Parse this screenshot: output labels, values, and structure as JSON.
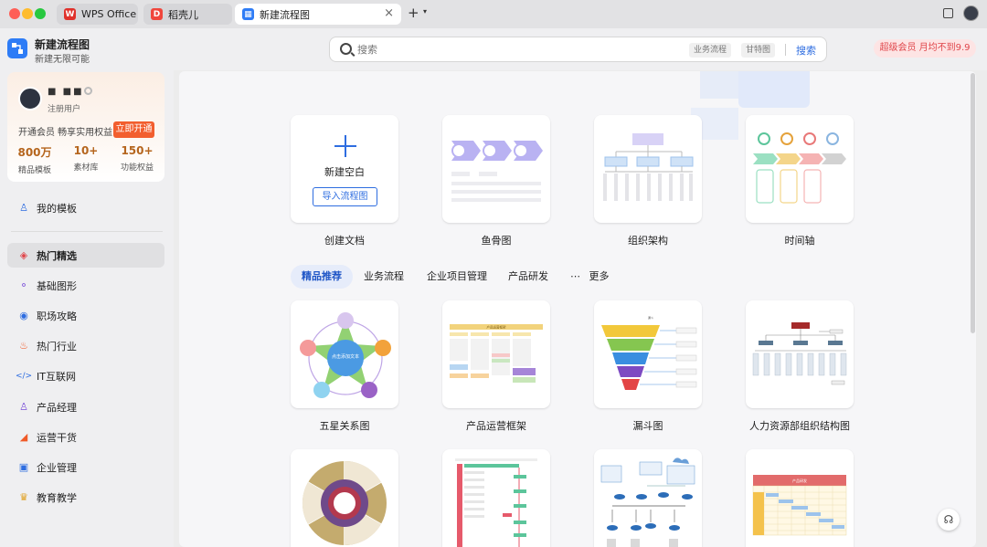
{
  "tabs": [
    {
      "label": "WPS Office",
      "icon": "wps-icon"
    },
    {
      "label": "稻壳儿",
      "icon": "docer-icon"
    },
    {
      "label": "新建流程图",
      "icon": "flowchart-icon",
      "active": true
    }
  ],
  "header": {
    "title": "新建流程图",
    "subtitle": "新建无限可能",
    "search_placeholder": "搜索",
    "search_chips": [
      "业务流程",
      "甘特图"
    ],
    "search_button": "搜索",
    "vip_badge": "超级会员 月均不到9.9"
  },
  "user": {
    "name": "■ ■■",
    "type": "注册用户",
    "promo": "开通会员 畅享实用权益",
    "open_button": "立即开通",
    "stats": [
      {
        "value": "800万",
        "label": "精品模板"
      },
      {
        "value": "10+",
        "label": "素材库"
      },
      {
        "value": "150+",
        "label": "功能权益"
      }
    ]
  },
  "nav": {
    "my_templates": "我的模板",
    "items": [
      {
        "label": "热门精选",
        "icon": "flame-diamond-icon",
        "selected": true
      },
      {
        "label": "基础图形",
        "icon": "shapes-icon"
      },
      {
        "label": "职场攻略",
        "icon": "person-circle-icon"
      },
      {
        "label": "热门行业",
        "icon": "fire-icon"
      },
      {
        "label": "IT互联网",
        "icon": "code-icon"
      },
      {
        "label": "产品经理",
        "icon": "user-group-icon"
      },
      {
        "label": "运营干货",
        "icon": "megaphone-icon"
      },
      {
        "label": "企业管理",
        "icon": "chat-box-icon"
      },
      {
        "label": "教育教学",
        "icon": "graduation-cap-icon"
      }
    ]
  },
  "create": {
    "new_blank": "新建空白",
    "import": "导入流程图",
    "types": [
      "创建文档",
      "鱼骨图",
      "组织架构",
      "时间轴"
    ]
  },
  "categories": [
    "精品推荐",
    "业务流程",
    "企业项目管理",
    "产品研发",
    "更多"
  ],
  "categories_more_icon": "⋯",
  "templates": [
    "五星关系图",
    "产品运营框架",
    "漏斗图",
    "人力资源部组织结构图"
  ],
  "template_text": {
    "star_center": "点击添加文本",
    "ops_title": "产品运营框架",
    "funnel_title": "漏斗",
    "gantt_title": "产品研发"
  },
  "colors": {
    "accent": "#2e6de0",
    "open_button": "#f25e2e",
    "vip_text": "#e0454a",
    "stat_value": "#b5651d"
  }
}
